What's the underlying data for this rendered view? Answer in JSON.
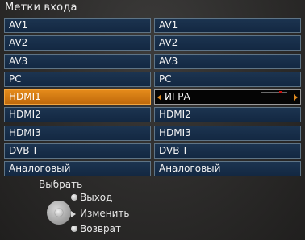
{
  "header": {
    "title": "Метки входа"
  },
  "rows": [
    {
      "input": "AV1",
      "label": "AV1",
      "selected": false
    },
    {
      "input": "AV2",
      "label": "AV2",
      "selected": false
    },
    {
      "input": "AV3",
      "label": "AV3",
      "selected": false
    },
    {
      "input": "PC",
      "label": "PC",
      "selected": false
    },
    {
      "input": "HDMI1",
      "label": "ИГРА",
      "selected": true
    },
    {
      "input": "HDMI2",
      "label": "HDMI2",
      "selected": false
    },
    {
      "input": "HDMI3",
      "label": "HDMI3",
      "selected": false
    },
    {
      "input": "DVB-T",
      "label": "DVB-T",
      "selected": false
    },
    {
      "input": "Аналоговый",
      "label": "Аналоговый",
      "selected": false
    }
  ],
  "help": {
    "select": "Выбрать",
    "exit": "Выход",
    "change": "Изменить",
    "back": "Возврат"
  },
  "colors": {
    "accent": "#e08b20",
    "row_bg": "#132842",
    "row_border": "#5e7486",
    "cursor_mark": "#d01010"
  }
}
